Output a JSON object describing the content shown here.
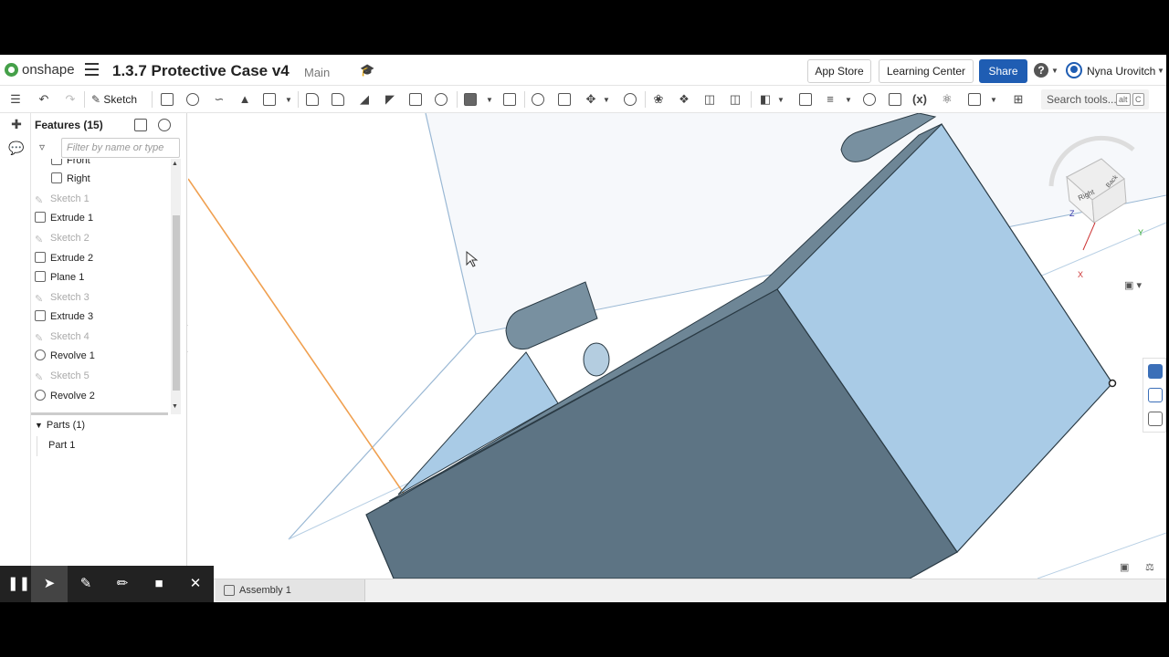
{
  "header": {
    "app_name": "onshape",
    "doc_title": "1.3.7 Protective Case v4",
    "branch": "Main",
    "app_store": "App Store",
    "learning_center": "Learning Center",
    "share": "Share",
    "help": "?",
    "user_name": "Nyna Urovitch"
  },
  "toolbar": {
    "sketch_label": "Sketch",
    "search_placeholder": "Search tools...",
    "search_shortcut": [
      "alt",
      "C"
    ],
    "variable_label": "(x)"
  },
  "features": {
    "title": "Features (15)",
    "filter_placeholder": "Filter by name or type",
    "items": [
      {
        "label": "Front",
        "type": "plane",
        "dim": false
      },
      {
        "label": "Right",
        "type": "plane",
        "dim": false
      },
      {
        "label": "Sketch 1",
        "type": "sketch",
        "dim": true
      },
      {
        "label": "Extrude 1",
        "type": "extrude",
        "dim": false
      },
      {
        "label": "Sketch 2",
        "type": "sketch",
        "dim": true
      },
      {
        "label": "Extrude 2",
        "type": "extrude",
        "dim": false
      },
      {
        "label": "Plane 1",
        "type": "plane",
        "dim": false
      },
      {
        "label": "Sketch 3",
        "type": "sketch",
        "dim": true
      },
      {
        "label": "Extrude 3",
        "type": "extrude",
        "dim": false
      },
      {
        "label": "Sketch 4",
        "type": "sketch",
        "dim": true
      },
      {
        "label": "Revolve 1",
        "type": "revolve",
        "dim": false
      },
      {
        "label": "Sketch 5",
        "type": "sketch",
        "dim": true
      },
      {
        "label": "Revolve 2",
        "type": "revolve",
        "dim": false
      }
    ],
    "parts_header": "Parts (1)",
    "parts": [
      "Part 1"
    ]
  },
  "view_cube": {
    "face_right": "Right",
    "face_back": "Back",
    "axis_x": "X",
    "axis_y": "Y",
    "axis_z": "Z"
  },
  "bottom": {
    "tab_label": "Assembly 1"
  },
  "colors": {
    "share_blue": "#1f5db3",
    "part_light": "#a9cbe6",
    "part_dark": "#5d7484",
    "plane_line": "#9ab8d4",
    "sketch_orange": "#f0a050"
  }
}
